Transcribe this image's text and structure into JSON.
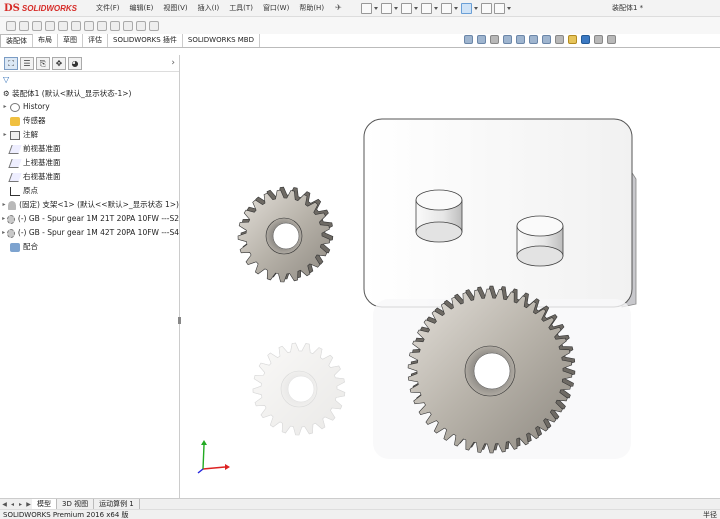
{
  "app": {
    "logo_prefix": "DS",
    "logo_text": "SOLIDWORKS",
    "document_title": "装配体1 *"
  },
  "menus": [
    "文件(F)",
    "编辑(E)",
    "视图(V)",
    "插入(I)",
    "工具(T)",
    "窗口(W)",
    "帮助(H)"
  ],
  "command_tabs": [
    "装配体",
    "布局",
    "草图",
    "评估",
    "SOLIDWORKS 插件",
    "SOLIDWORKS MBD"
  ],
  "active_command_tab": "装配体",
  "feature_tree": {
    "filter_icon": "filter-icon",
    "root": "装配体1 (默认<默认_显示状态-1>)",
    "items": [
      {
        "label": "History",
        "icon": "history-icon",
        "expandable": true
      },
      {
        "label": "传感器",
        "icon": "sensor-icon",
        "expandable": false
      },
      {
        "label": "注解",
        "icon": "annotation-icon",
        "expandable": true
      },
      {
        "label": "前视基准面",
        "icon": "plane-icon",
        "expandable": false
      },
      {
        "label": "上视基准面",
        "icon": "plane-icon",
        "expandable": false
      },
      {
        "label": "右视基准面",
        "icon": "plane-icon",
        "expandable": false
      },
      {
        "label": "原点",
        "icon": "origin-icon",
        "expandable": false
      },
      {
        "label": "(固定) 支架<1> (默认<<默认>_显示状态 1>)",
        "icon": "part-icon",
        "expandable": true
      },
      {
        "label": "(-) GB - Spur gear 1M 21T 20PA 10FW ---S2",
        "icon": "gear-icon",
        "expandable": true
      },
      {
        "label": "(-) GB - Spur gear 1M 42T 20PA 10FW ---S4",
        "icon": "gear-icon",
        "expandable": true
      },
      {
        "label": "配合",
        "icon": "mate-icon",
        "expandable": false
      }
    ]
  },
  "bottom_tabs": [
    "模型",
    "3D 视图",
    "运动算例 1"
  ],
  "active_bottom_tab": "模型",
  "status": {
    "left": "SOLIDWORKS Premium 2016 x64 版",
    "right": "半径"
  },
  "colors": {
    "accent_red": "#d62b27",
    "selection_blue": "#cfe3f7"
  }
}
